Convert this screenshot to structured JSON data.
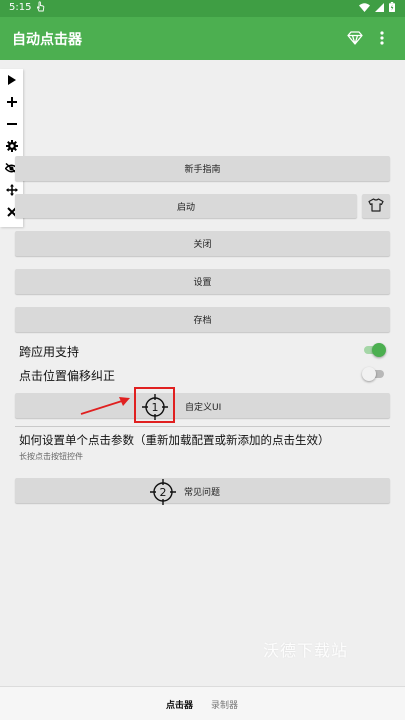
{
  "status_bar": {
    "time": "5:15",
    "icons": [
      "touch-icon",
      "wifi-icon",
      "signal-icon",
      "battery-icon"
    ]
  },
  "app_bar": {
    "title": "自动点击器",
    "icons": [
      "diamond-icon",
      "more-vert-icon"
    ]
  },
  "float_toolbar": {
    "icons": [
      "play-icon",
      "plus-icon",
      "minus-icon",
      "gear-icon",
      "eye-off-icon",
      "move-icon",
      "close-icon"
    ]
  },
  "buttons": {
    "guide": "新手指南",
    "start": "启动",
    "close": "关闭",
    "settings": "设置",
    "save": "存档",
    "custom_ui": "自定义UI",
    "faq": "常见问题"
  },
  "target_numbers": {
    "first": "1",
    "second": "2"
  },
  "toggles": [
    {
      "label": "跨应用支持",
      "on": true
    },
    {
      "label": "点击位置偏移纠正",
      "on": false
    }
  ],
  "info": {
    "title": "如何设置单个点击参数（重新加载配置或新添加的点击生效）",
    "subtitle": "长按点击按钮控件"
  },
  "watermark": "沃德下载站",
  "bottom_nav": {
    "tabs": [
      "点击器",
      "录制器"
    ],
    "active": 0
  },
  "colors": {
    "primary": "#4caf50",
    "status_bar": "#3f9e44",
    "button": "#d9d9d9",
    "highlight": "#e02020"
  }
}
